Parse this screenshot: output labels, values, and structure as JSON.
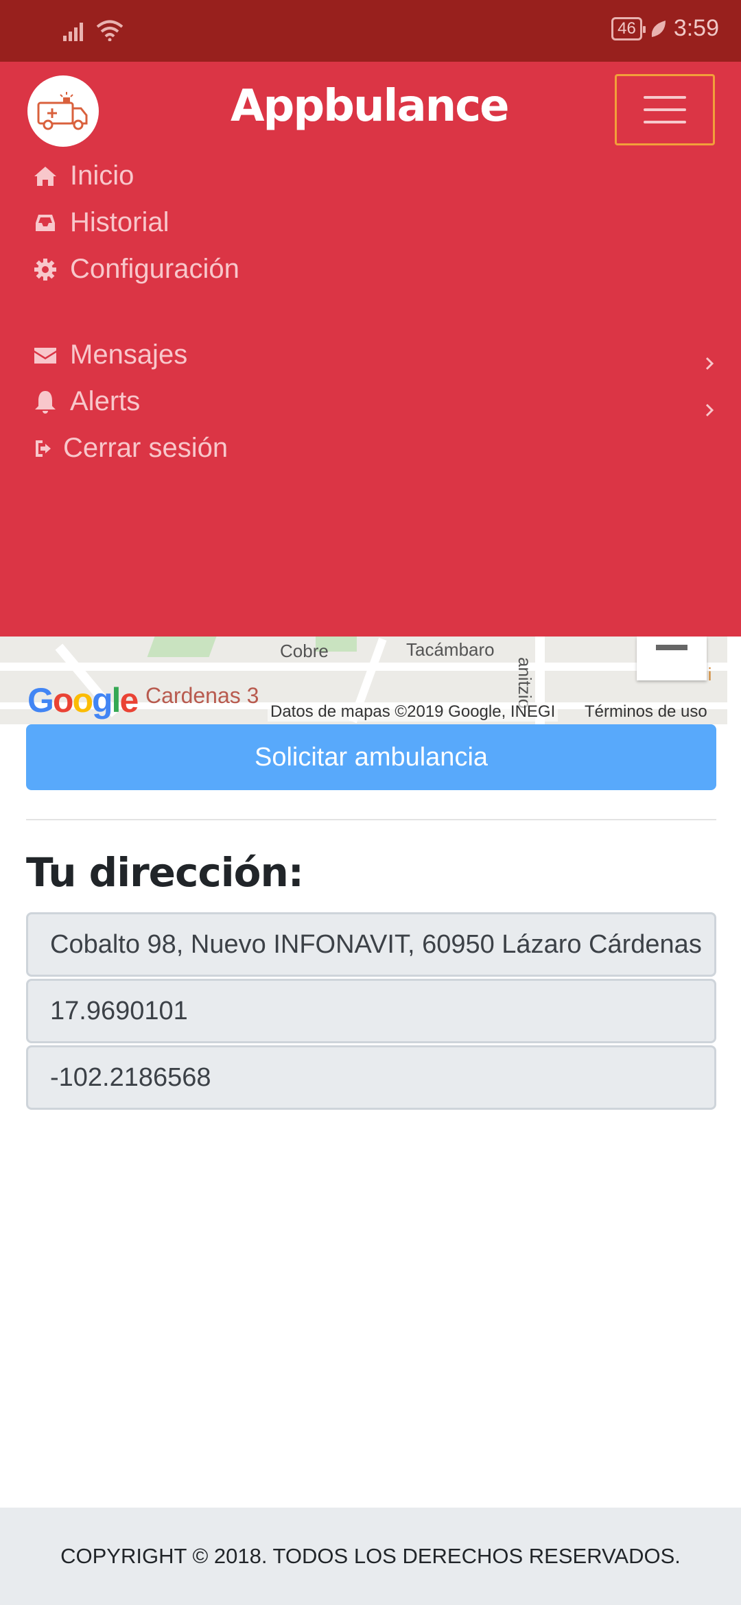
{
  "status_bar": {
    "battery": "46",
    "time": "3:59"
  },
  "header": {
    "brand": "Appbulance"
  },
  "nav": {
    "items": [
      {
        "label": "Inicio",
        "icon": "home-icon"
      },
      {
        "label": "Historial",
        "icon": "inbox-icon"
      },
      {
        "label": "Configuración",
        "icon": "gear-icon"
      },
      {
        "label": "Mensajes",
        "icon": "envelope-icon"
      },
      {
        "label": "Alerts",
        "icon": "bell-icon"
      },
      {
        "label": "Cerrar sesión",
        "icon": "sign-out-icon"
      }
    ]
  },
  "map": {
    "labels": [
      "Cobre",
      "Tacámbaro",
      "Cardenas 3",
      "anitzio",
      "Mi"
    ],
    "logo": "Google",
    "credit": "Datos de mapas ©2019 Google, INEGI",
    "terms": "Términos de uso"
  },
  "main": {
    "request_button": "Solicitar ambulancia",
    "address_title": "Tu dirección:",
    "address": "Cobalto 98, Nuevo INFONAVIT, 60950 Lázaro Cárdenas",
    "latitude": "17.9690101",
    "longitude": "-102.2186568"
  },
  "footer": {
    "copyright": "COPYRIGHT © 2018. TODOS LOS DERECHOS RESERVADOS."
  },
  "colors": {
    "nav_bg": "#db3545",
    "status_bg": "#98201d",
    "button": "#58a9fb"
  }
}
